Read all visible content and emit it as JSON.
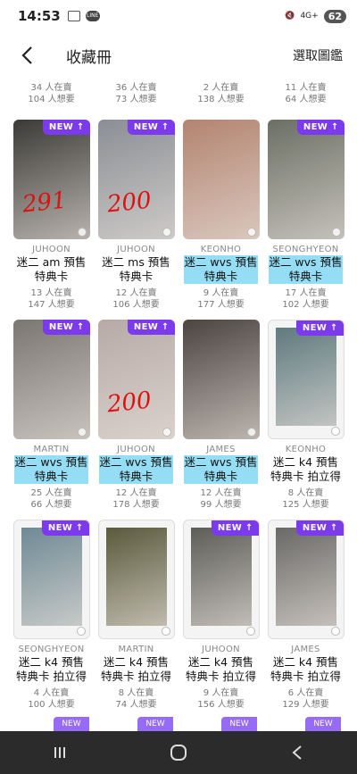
{
  "status_bar": {
    "time": "14:53",
    "battery": "62",
    "signal": "4G+"
  },
  "header": {
    "title": "收藏冊",
    "select_label": "選取圖鑑"
  },
  "partial_row": [
    {
      "have": "34 人在賣",
      "want": "104 人想要"
    },
    {
      "have": "36 人在賣",
      "want": "73 人想要"
    },
    {
      "have": "2 人在賣",
      "want": "138 人想要"
    },
    {
      "have": "11 人在賣",
      "want": "64 人想要"
    }
  ],
  "rows": [
    [
      {
        "new": "NEW ↑",
        "member": "JUHOON",
        "name": "迷二 am 預售\n特典卡",
        "have": "13 人在賣",
        "want": "147 人想要",
        "handwrite": "291",
        "photo": "#3b3a36"
      },
      {
        "new": "NEW ↑",
        "member": "JUHOON",
        "name": "迷二 ms 預售\n特典卡",
        "have": "12 人在賣",
        "want": "106 人想要",
        "handwrite": "200",
        "photo": "#8a8e94"
      },
      {
        "new": "",
        "member": "KEONHO",
        "name": "迷二 wvs 預售\n特典卡",
        "have": "9 人在賣",
        "want": "177 人想要",
        "handwrite": "",
        "photo": "#b38470"
      },
      {
        "new": "NEW ↑",
        "member": "SEONGHYEON",
        "name": "迷二 wvs 預售\n特典卡",
        "have": "17 人在賣",
        "want": "102 人想要",
        "handwrite": "",
        "photo": "#6b6f64"
      }
    ],
    [
      {
        "new": "NEW ↑",
        "member": "MARTIN",
        "name": "迷二 wvs 預售\n特典卡",
        "have": "25 人在賣",
        "want": "66 人想要",
        "handwrite": "",
        "photo": "#7a7672"
      },
      {
        "new": "NEW ↑",
        "member": "JUHOON",
        "name": "迷二 wvs 預售\n特典卡",
        "have": "12 人在賣",
        "want": "178 人想要",
        "handwrite": "200",
        "photo": "#b7aaa6"
      },
      {
        "new": "",
        "member": "JAMES",
        "name": "迷二 wvs 預售\n特典卡",
        "have": "12 人在賣",
        "want": "99 人想要",
        "handwrite": "",
        "photo": "#4b4440"
      },
      {
        "new": "NEW ↑",
        "member": "KEONHO",
        "name": "迷二 k4 預售\n特典卡 拍立得",
        "have": "8 人在賣",
        "want": "125 人想要",
        "handwrite": "",
        "photo": "#5f7a7f",
        "polaroid": true
      }
    ],
    [
      {
        "new": "NEW ↑",
        "member": "SEONGHYEON",
        "name": "迷二 k4 預售\n特典卡 拍立得",
        "have": "4 人在賣",
        "want": "100 人想要",
        "handwrite": "",
        "photo": "#6f8a95",
        "polaroid": true
      },
      {
        "new": "",
        "member": "MARTIN",
        "name": "迷二 k4 預售\n特典卡 拍立得",
        "have": "8 人在賣",
        "want": "74 人想要",
        "handwrite": "",
        "photo": "#5a5a3c",
        "polaroid": true
      },
      {
        "new": "NEW ↑",
        "member": "JUHOON",
        "name": "迷二 k4 預售\n特典卡 拍立得",
        "have": "9 人在賣",
        "want": "156 人想要",
        "handwrite": "",
        "photo": "#5d5d58",
        "polaroid": true
      },
      {
        "new": "NEW ↑",
        "member": "JAMES",
        "name": "迷二 k4 預售\n特典卡 拍立得",
        "have": "6 人在賣",
        "want": "129 人想要",
        "handwrite": "",
        "photo": "#6a6967",
        "polaroid": true
      }
    ]
  ],
  "peek_tags": [
    "NEW",
    "NEW",
    "NEW",
    "NEW"
  ]
}
